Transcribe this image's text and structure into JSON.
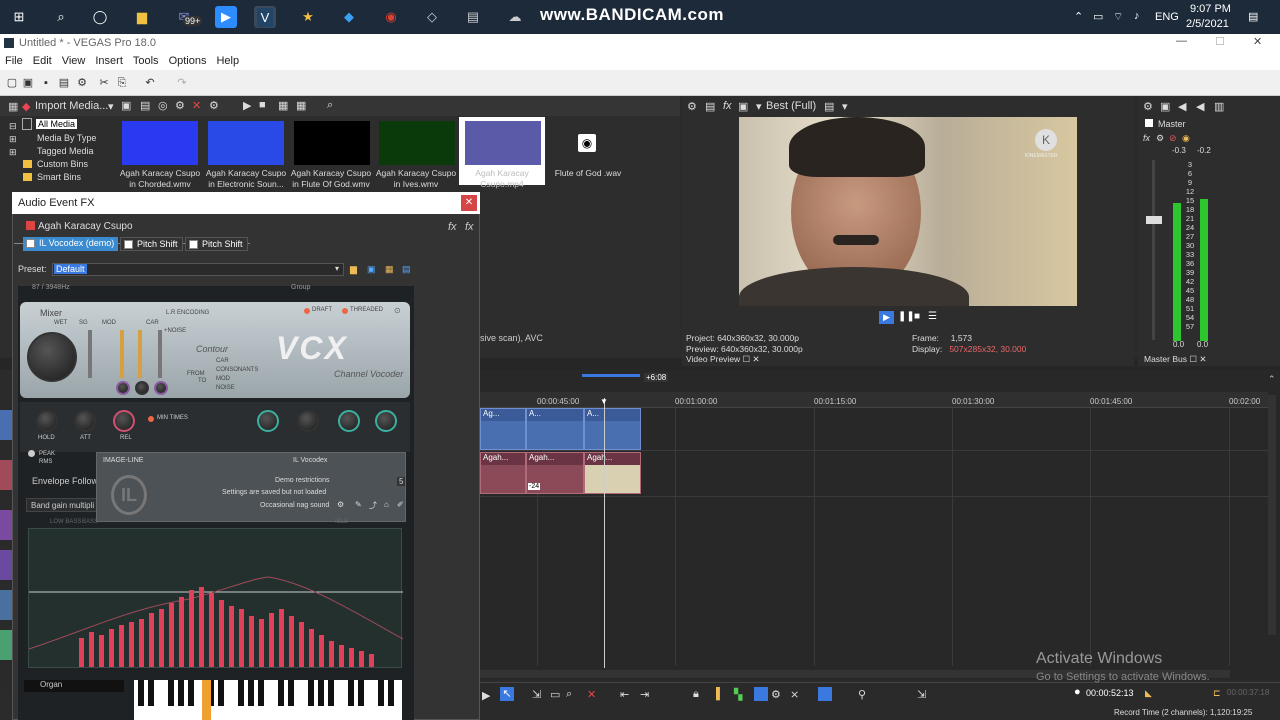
{
  "taskbar": {
    "badge": "99+",
    "bandicam": "www.BANDICAM.com",
    "lang": "ENG",
    "time": "9:07 PM",
    "date": "2/5/2021"
  },
  "window": {
    "title": "Untitled * - VEGAS Pro 18.0"
  },
  "menu": [
    "File",
    "Edit",
    "View",
    "Insert",
    "Tools",
    "Options",
    "Help"
  ],
  "media": {
    "import_label": "Import Media...",
    "tree": [
      "All Media",
      "Media By Type",
      "Tagged Media",
      "Custom Bins",
      "Smart Bins"
    ],
    "thumbs": [
      {
        "label": "Agah Karacay Csupo in Chorded.wmv",
        "color": "#2a3af0"
      },
      {
        "label": "Agah Karacay Csupo in Electronic Soun...",
        "color": "#2a4ae8"
      },
      {
        "label": "Agah Karacay Csupo in Flute Of God.wmv",
        "color": "#000000"
      },
      {
        "label": "Agah Karacay Csupo in Ives.wmv",
        "color": "#0a3a0a"
      },
      {
        "label": "Agah Karacay Csupo.mp4",
        "color": "#5a5aa8"
      },
      {
        "label": "Flute of God .wav",
        "color": "#2d2d2d"
      }
    ],
    "status": "sive scan), AVC"
  },
  "preview": {
    "quality": "Best (Full)",
    "watermark": "KINEMASTER",
    "project_label": "Project:",
    "project_val": "640x360x32, 30.000p",
    "preview_label": "Preview:",
    "preview_val": "640x360x32, 30.000p",
    "frame_label": "Frame:",
    "frame_val": "1,573",
    "display_label": "Display:",
    "display_val": "507x285x32, 30.000",
    "tab": "Video Preview"
  },
  "master": {
    "title": "Master",
    "peak_l": "-0.3",
    "peak_r": "-0.2",
    "scale": [
      "3",
      "6",
      "9",
      "12",
      "15",
      "18",
      "21",
      "24",
      "27",
      "30",
      "33",
      "36",
      "39",
      "42",
      "45",
      "48",
      "51",
      "54",
      "57"
    ],
    "bottom_l": "0.0",
    "bottom_r": "0.0",
    "tab": "Master Bus"
  },
  "timeline": {
    "cursor_label": "+6:08",
    "ruler": [
      "00:00:45:00",
      "00:01:00:00",
      "00:01:15:00",
      "00:01:30:00",
      "00:01:45:00",
      "00:02:00"
    ],
    "clips_v": [
      "Ag...",
      "A...",
      "A..."
    ],
    "clips_a": [
      "Agah...",
      "Agah...",
      "Agah..."
    ],
    "gain": "-24",
    "timecode": "00:00:52:13",
    "end_time": "00:00:37:18",
    "record_time": "Record Time (2 channels): 1,120:19:25",
    "activate_title": "Activate Windows",
    "activate_sub": "Go to Settings to activate Windows."
  },
  "fx": {
    "title": "Audio Event FX",
    "event": "Agah Karacay Csupo",
    "chain": [
      "IL Vocodex (demo)",
      "Pitch Shift",
      "Pitch Shift"
    ],
    "preset_label": "Preset:",
    "preset_val": "Default",
    "plugin": {
      "band_info": "87 / 3948Hz",
      "group": "Group",
      "mixer": "Mixer",
      "wet": "WET",
      "sg": "SG",
      "mod": "MOD",
      "car": "CAR",
      "noise": "+NOISE",
      "lr_enc": "L.R ENCODING",
      "draft": "DRAFT",
      "threaded": "THREADED",
      "brand": "VCX",
      "subtitle": "Channel Vocoder",
      "contour": "Contour",
      "contour_items": [
        "CAR",
        "CONSONANTS",
        "MOD",
        "NOISE"
      ],
      "from": "FROM",
      "to": "TO",
      "hold": "HOLD",
      "att": "ATT",
      "rel": "REL",
      "min_times": "MIN TIMES",
      "peak": "PEAK",
      "rms": "RMS",
      "envelope": "Envelope Follow",
      "band_gain": "Band gain multipli",
      "overlay_brand": "IMAGE-LINE",
      "overlay_product": "IL Vocodex",
      "demo1": "Demo restrictions",
      "demo2": "Settings are saved but not loaded",
      "demo3": "Occasional nag sound",
      "overlay_num": "5",
      "freq_labels": [
        "LOW BASS",
        "BASS",
        "IBLE"
      ],
      "organ": "Organ"
    }
  }
}
